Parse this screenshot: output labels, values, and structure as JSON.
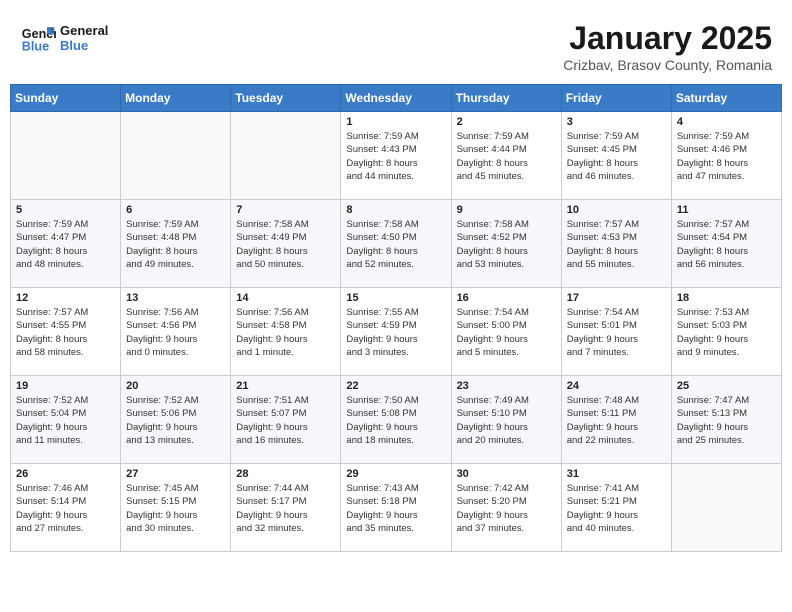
{
  "header": {
    "logo_line1": "General",
    "logo_line2": "Blue",
    "month": "January 2025",
    "location": "Crizbav, Brasov County, Romania"
  },
  "days_of_week": [
    "Sunday",
    "Monday",
    "Tuesday",
    "Wednesday",
    "Thursday",
    "Friday",
    "Saturday"
  ],
  "weeks": [
    [
      {
        "day": "",
        "info": ""
      },
      {
        "day": "",
        "info": ""
      },
      {
        "day": "",
        "info": ""
      },
      {
        "day": "1",
        "info": "Sunrise: 7:59 AM\nSunset: 4:43 PM\nDaylight: 8 hours\nand 44 minutes."
      },
      {
        "day": "2",
        "info": "Sunrise: 7:59 AM\nSunset: 4:44 PM\nDaylight: 8 hours\nand 45 minutes."
      },
      {
        "day": "3",
        "info": "Sunrise: 7:59 AM\nSunset: 4:45 PM\nDaylight: 8 hours\nand 46 minutes."
      },
      {
        "day": "4",
        "info": "Sunrise: 7:59 AM\nSunset: 4:46 PM\nDaylight: 8 hours\nand 47 minutes."
      }
    ],
    [
      {
        "day": "5",
        "info": "Sunrise: 7:59 AM\nSunset: 4:47 PM\nDaylight: 8 hours\nand 48 minutes."
      },
      {
        "day": "6",
        "info": "Sunrise: 7:59 AM\nSunset: 4:48 PM\nDaylight: 8 hours\nand 49 minutes."
      },
      {
        "day": "7",
        "info": "Sunrise: 7:58 AM\nSunset: 4:49 PM\nDaylight: 8 hours\nand 50 minutes."
      },
      {
        "day": "8",
        "info": "Sunrise: 7:58 AM\nSunset: 4:50 PM\nDaylight: 8 hours\nand 52 minutes."
      },
      {
        "day": "9",
        "info": "Sunrise: 7:58 AM\nSunset: 4:52 PM\nDaylight: 8 hours\nand 53 minutes."
      },
      {
        "day": "10",
        "info": "Sunrise: 7:57 AM\nSunset: 4:53 PM\nDaylight: 8 hours\nand 55 minutes."
      },
      {
        "day": "11",
        "info": "Sunrise: 7:57 AM\nSunset: 4:54 PM\nDaylight: 8 hours\nand 56 minutes."
      }
    ],
    [
      {
        "day": "12",
        "info": "Sunrise: 7:57 AM\nSunset: 4:55 PM\nDaylight: 8 hours\nand 58 minutes."
      },
      {
        "day": "13",
        "info": "Sunrise: 7:56 AM\nSunset: 4:56 PM\nDaylight: 9 hours\nand 0 minutes."
      },
      {
        "day": "14",
        "info": "Sunrise: 7:56 AM\nSunset: 4:58 PM\nDaylight: 9 hours\nand 1 minute."
      },
      {
        "day": "15",
        "info": "Sunrise: 7:55 AM\nSunset: 4:59 PM\nDaylight: 9 hours\nand 3 minutes."
      },
      {
        "day": "16",
        "info": "Sunrise: 7:54 AM\nSunset: 5:00 PM\nDaylight: 9 hours\nand 5 minutes."
      },
      {
        "day": "17",
        "info": "Sunrise: 7:54 AM\nSunset: 5:01 PM\nDaylight: 9 hours\nand 7 minutes."
      },
      {
        "day": "18",
        "info": "Sunrise: 7:53 AM\nSunset: 5:03 PM\nDaylight: 9 hours\nand 9 minutes."
      }
    ],
    [
      {
        "day": "19",
        "info": "Sunrise: 7:52 AM\nSunset: 5:04 PM\nDaylight: 9 hours\nand 11 minutes."
      },
      {
        "day": "20",
        "info": "Sunrise: 7:52 AM\nSunset: 5:06 PM\nDaylight: 9 hours\nand 13 minutes."
      },
      {
        "day": "21",
        "info": "Sunrise: 7:51 AM\nSunset: 5:07 PM\nDaylight: 9 hours\nand 16 minutes."
      },
      {
        "day": "22",
        "info": "Sunrise: 7:50 AM\nSunset: 5:08 PM\nDaylight: 9 hours\nand 18 minutes."
      },
      {
        "day": "23",
        "info": "Sunrise: 7:49 AM\nSunset: 5:10 PM\nDaylight: 9 hours\nand 20 minutes."
      },
      {
        "day": "24",
        "info": "Sunrise: 7:48 AM\nSunset: 5:11 PM\nDaylight: 9 hours\nand 22 minutes."
      },
      {
        "day": "25",
        "info": "Sunrise: 7:47 AM\nSunset: 5:13 PM\nDaylight: 9 hours\nand 25 minutes."
      }
    ],
    [
      {
        "day": "26",
        "info": "Sunrise: 7:46 AM\nSunset: 5:14 PM\nDaylight: 9 hours\nand 27 minutes."
      },
      {
        "day": "27",
        "info": "Sunrise: 7:45 AM\nSunset: 5:15 PM\nDaylight: 9 hours\nand 30 minutes."
      },
      {
        "day": "28",
        "info": "Sunrise: 7:44 AM\nSunset: 5:17 PM\nDaylight: 9 hours\nand 32 minutes."
      },
      {
        "day": "29",
        "info": "Sunrise: 7:43 AM\nSunset: 5:18 PM\nDaylight: 9 hours\nand 35 minutes."
      },
      {
        "day": "30",
        "info": "Sunrise: 7:42 AM\nSunset: 5:20 PM\nDaylight: 9 hours\nand 37 minutes."
      },
      {
        "day": "31",
        "info": "Sunrise: 7:41 AM\nSunset: 5:21 PM\nDaylight: 9 hours\nand 40 minutes."
      },
      {
        "day": "",
        "info": ""
      }
    ]
  ]
}
